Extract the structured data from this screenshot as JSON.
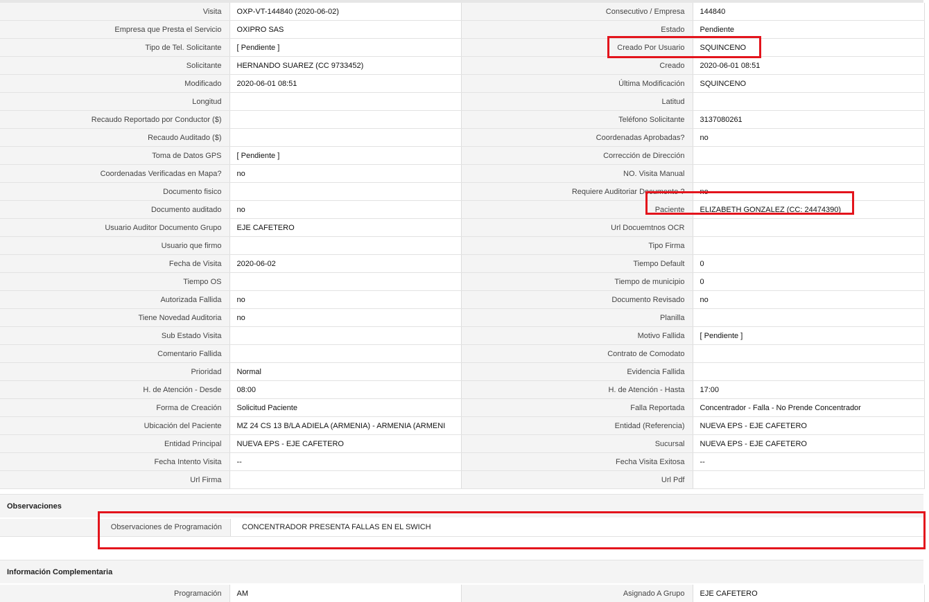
{
  "rows": [
    {
      "l1": "Visita",
      "v1": "OXP-VT-144840 (2020-06-02)",
      "l2": "Consecutivo / Empresa",
      "v2": "144840"
    },
    {
      "l1": "Empresa que Presta el Servicio",
      "v1": "OXIPRO SAS",
      "l2": "Estado",
      "v2": "Pendiente"
    },
    {
      "l1": "Tipo de Tel. Solicitante",
      "v1": "[ Pendiente ]",
      "l2": "Creado Por Usuario",
      "v2": "SQUINCENO"
    },
    {
      "l1": "Solicitante",
      "v1": "HERNANDO SUAREZ (CC 9733452)",
      "l2": "Creado",
      "v2": "2020-06-01 08:51"
    },
    {
      "l1": "Modificado",
      "v1": "2020-06-01 08:51",
      "l2": "Última Modificación",
      "v2": " SQUINCENO"
    },
    {
      "l1": "Longitud",
      "v1": "",
      "l2": "Latitud",
      "v2": ""
    },
    {
      "l1": "Recaudo Reportado por Conductor ($)",
      "v1": "",
      "l2": "Teléfono Solicitante",
      "v2": "3137080261"
    },
    {
      "l1": "Recaudo Auditado ($)",
      "v1": "",
      "l2": "Coordenadas Aprobadas?",
      "v2": " no"
    },
    {
      "l1": "Toma de Datos GPS",
      "v1": "[ Pendiente ]",
      "l2": "Corrección de Dirección",
      "v2": ""
    },
    {
      "l1": "Coordenadas Verificadas en Mapa?",
      "v1": " no",
      "l2": "NO. Visita Manual",
      "v2": ""
    },
    {
      "l1": "Documento fisico",
      "v1": "",
      "l2": "Requiere Auditoriar Documento ?",
      "v2": " no"
    },
    {
      "l1": "Documento auditado",
      "v1": " no",
      "l2": "Paciente",
      "v2": "ELIZABETH GONZALEZ (CC: 24474390)"
    },
    {
      "l1": "Usuario Auditor Documento Grupo",
      "v1": "EJE CAFETERO",
      "l2": "Url Docuemtnos OCR",
      "v2": ""
    },
    {
      "l1": "Usuario que firmo",
      "v1": "",
      "l2": "Tipo Firma",
      "v2": ""
    },
    {
      "l1": "Fecha de Visita",
      "v1": " 2020-06-02",
      "l2": "Tiempo Default",
      "v2": "0"
    },
    {
      "l1": "Tiempo OS",
      "v1": "",
      "l2": "Tiempo de municipio",
      "v2": "0"
    },
    {
      "l1": "Autorizada Fallida",
      "v1": " no",
      "l2": "Documento Revisado",
      "v2": " no"
    },
    {
      "l1": "Tiene Novedad Auditoria",
      "v1": " no",
      "l2": "Planilla",
      "v2": ""
    },
    {
      "l1": "Sub Estado Visita",
      "v1": "",
      "l2": "Motivo Fallida",
      "v2": "[ Pendiente ]"
    },
    {
      "l1": "Comentario Fallida",
      "v1": "",
      "l2": "Contrato de Comodato",
      "v2": ""
    },
    {
      "l1": "Prioridad",
      "v1": "Normal",
      "l2": "Evidencia Fallida",
      "v2": ""
    },
    {
      "l1": "H. de Atención - Desde",
      "v1": "08:00",
      "l2": "H. de Atención - Hasta",
      "v2": "17:00"
    },
    {
      "l1": "Forma de Creación",
      "v1": "Solicitud Paciente",
      "l2": "Falla Reportada",
      "v2": "Concentrador - Falla - No Prende Concentrador"
    },
    {
      "l1": "Ubicación del Paciente",
      "v1": "MZ 24 CS 13 B/LA ADIELA (ARMENIA) - ARMENIA (ARMENI",
      "l2": "Entidad (Referencia)",
      "v2": "NUEVA EPS - EJE CAFETERO"
    },
    {
      "l1": "Entidad Principal",
      "v1": "NUEVA EPS - EJE CAFETERO",
      "l2": "Sucursal",
      "v2": "NUEVA EPS - EJE CAFETERO"
    },
    {
      "l1": "Fecha Intento Visita",
      "v1": " --",
      "l2": "Fecha Visita Exitosa",
      "v2": " --"
    },
    {
      "l1": "Url Firma",
      "v1": "",
      "l2": "Url Pdf",
      "v2": ""
    }
  ],
  "observaciones": {
    "title": "Observaciones",
    "label": "Observaciones de Programación",
    "value": "CONCENTRADOR PRESENTA FALLAS EN EL SWICH"
  },
  "complementaria": {
    "title": "Información Complementaria",
    "l1": "Programación",
    "v1": "AM",
    "l2": "Asignado A Grupo",
    "v2": "EJE CAFETERO"
  },
  "colors": {
    "highlight": "#e3141c",
    "label_bg": "#f4f4f4"
  }
}
